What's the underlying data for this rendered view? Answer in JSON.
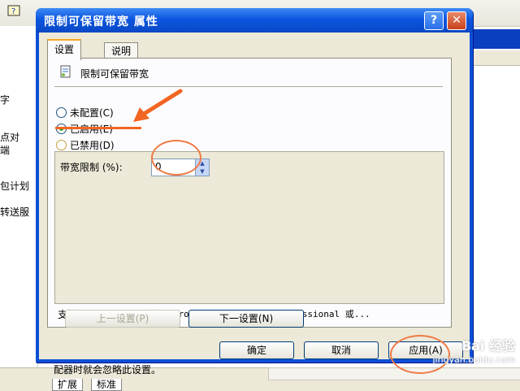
{
  "background": {
    "fragments": [
      "字",
      "点对",
      "端",
      "包计划",
      "转送服"
    ],
    "status_text": "配器时就会忽略此设置。",
    "tabs": [
      "扩展",
      "标准"
    ]
  },
  "dialog": {
    "title": "限制可保留带宽 属性",
    "help_button": "?",
    "close_button": "✕",
    "tabs": [
      "设置",
      "说明"
    ],
    "policy_title": "限制可保留带宽",
    "radios": [
      {
        "label": "未配置(C)",
        "checked": false
      },
      {
        "label": "已启用(E)",
        "checked": true
      },
      {
        "label": "已禁用(D)",
        "checked": false
      }
    ],
    "bandwidth_label": "带宽限制 (%):",
    "bandwidth_value": "0",
    "supported_label": "支持于:",
    "supported_value": "至少 Microsoft Windows XP Professional 或...",
    "buttons": {
      "prev": "上一设置(P)",
      "next": "下一设置(N)",
      "ok": "确定",
      "cancel": "取消",
      "apply": "应用(A)"
    }
  },
  "watermark": {
    "logo": "Bai 经验",
    "url": "jingyan.baidu.com"
  },
  "colors": {
    "titlebar": "#0c55e0",
    "annotation": "#f26522",
    "dialog_bg": "#ece9d8"
  }
}
